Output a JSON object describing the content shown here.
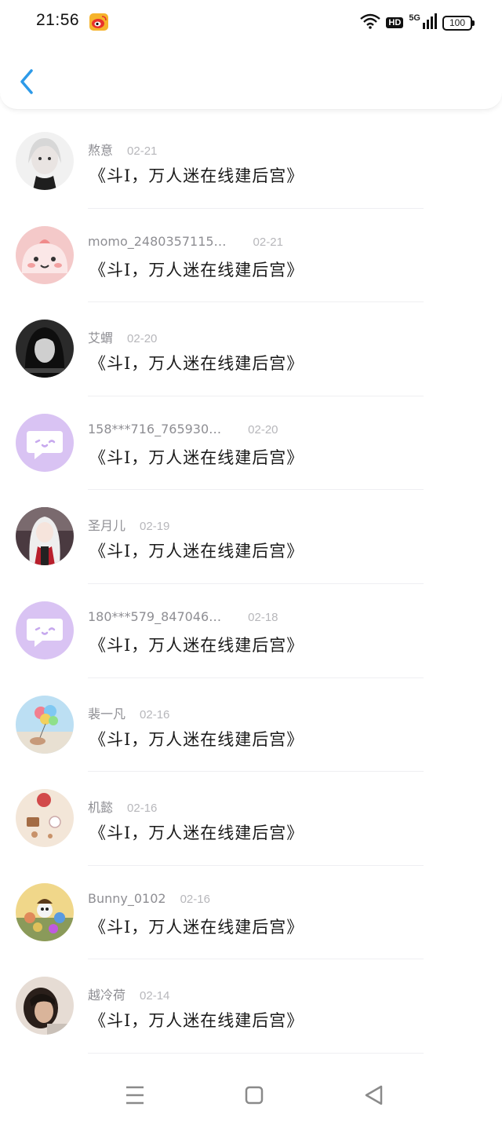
{
  "status_bar": {
    "time": "21:56",
    "hd": "HD",
    "network": "5G",
    "battery": "100"
  },
  "header": {
    "back_icon": "chevron-left-icon",
    "accent_color": "#2d9ae8"
  },
  "comments": [
    {
      "name": "熬意",
      "date": "02-21",
      "message": "《斗I，万人迷在线建后宫》",
      "avatar": "anime-portrait"
    },
    {
      "name": "momo_2480357115…",
      "date": "02-21",
      "message": "《斗I，万人迷在线建后宫》",
      "avatar": "pink-blob"
    },
    {
      "name": "艾蝟",
      "date": "02-20",
      "message": "《斗I，万人迷在线建后宫》",
      "avatar": "dark-portrait"
    },
    {
      "name": "158***716_765930…",
      "date": "02-20",
      "message": "《斗I，万人迷在线建后宫》",
      "avatar": "default-chat"
    },
    {
      "name": "圣月儿",
      "date": "02-19",
      "message": "《斗I，万人迷在线建后宫》",
      "avatar": "anime-girl"
    },
    {
      "name": "180***579_847046…",
      "date": "02-18",
      "message": "《斗I，万人迷在线建后宫》",
      "avatar": "default-chat"
    },
    {
      "name": "裴一凡",
      "date": "02-16",
      "message": "《斗I，万人迷在线建后宫》",
      "avatar": "balloons"
    },
    {
      "name": "机懿",
      "date": "02-16",
      "message": "《斗I，万人迷在线建后宫》",
      "avatar": "cafe"
    },
    {
      "name": "Bunny_0102",
      "date": "02-16",
      "message": "《斗I，万人迷在线建后宫》",
      "avatar": "cartoon-crowd"
    },
    {
      "name": "越冷荷",
      "date": "02-14",
      "message": "《斗I，万人迷在线建后宫》",
      "avatar": "portrait"
    }
  ],
  "nav_bar": {
    "menu_icon": "menu-icon",
    "home_icon": "home-square-icon",
    "back_icon": "back-triangle-icon"
  }
}
